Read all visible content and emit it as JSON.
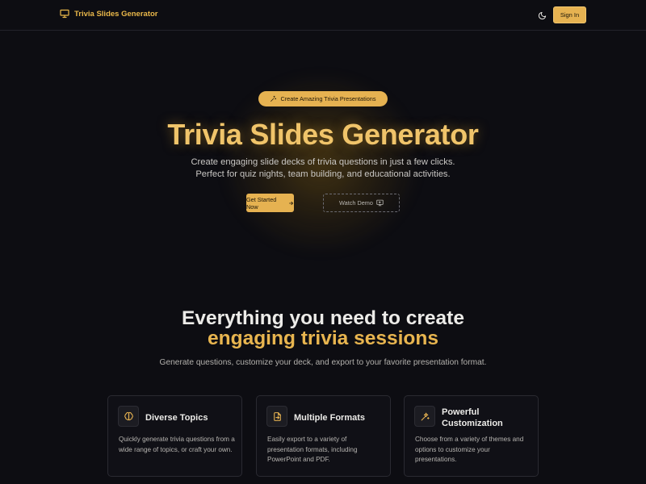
{
  "header": {
    "brand_icon": "presentation-icon",
    "brand_title": "Trivia Slides Generator",
    "theme_icon": "moon-icon",
    "signin_label": "Sign In"
  },
  "hero": {
    "badge_icon": "sparkles-icon",
    "badge_text": "Create Amazing Trivia Presentations",
    "title": "Trivia Slides Generator",
    "subtitle_line1": "Create engaging slide decks of trivia questions in just a few clicks.",
    "subtitle_line2": "Perfect for quiz nights, team building, and educational activities.",
    "cta_primary": "Get Started Now",
    "cta_primary_icon": "arrow-right-icon",
    "cta_secondary": "Watch Demo",
    "cta_secondary_icon": "monitor-play-icon"
  },
  "features": {
    "title_line1": "Everything you need to create",
    "title_line2": "engaging trivia sessions",
    "subtitle": "Generate questions, customize your deck, and export to your favorite presentation format.",
    "cards": [
      {
        "icon": "brain-icon",
        "title": "Diverse Topics",
        "description": "Quickly generate trivia questions from a wide range of topics, or craft your own."
      },
      {
        "icon": "file-export-icon",
        "title": "Multiple Formats",
        "description": "Easily export to a variety of presentation formats, including PowerPoint and PDF."
      },
      {
        "icon": "wand-sparkles-icon",
        "title": "Powerful Customization",
        "description": "Choose from a variety of themes and options to customize your presentations."
      }
    ]
  },
  "colors": {
    "background": "#0d0d12",
    "accent": "#e6b251",
    "accent_text": "#f0c46a"
  }
}
